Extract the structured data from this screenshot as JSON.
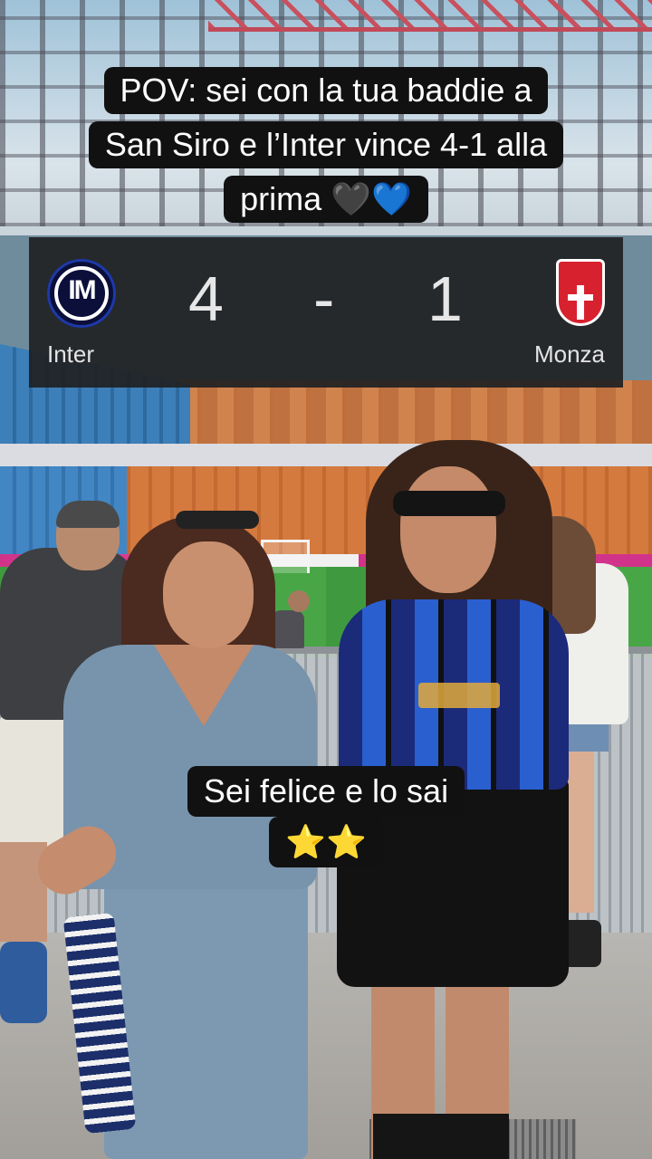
{
  "caption_top": {
    "line1": "POV: sei con la tua baddie a",
    "line2": "San Siro e l’Inter vince 4-1 alla",
    "line3": "prima 🖤💙"
  },
  "scoreboard": {
    "home_team": "Inter",
    "home_score": "4",
    "separator": "-",
    "away_score": "1",
    "away_team": "Monza",
    "home_logo_icon": "inter-crest-icon",
    "away_logo_icon": "monza-crest-icon",
    "colors": {
      "panel": "#202124",
      "home_logo": "#1e3aa8",
      "away_logo": "#d8212f"
    }
  },
  "caption_mid": {
    "line1": "Sei felice e lo sai",
    "line2": "⭐⭐"
  }
}
